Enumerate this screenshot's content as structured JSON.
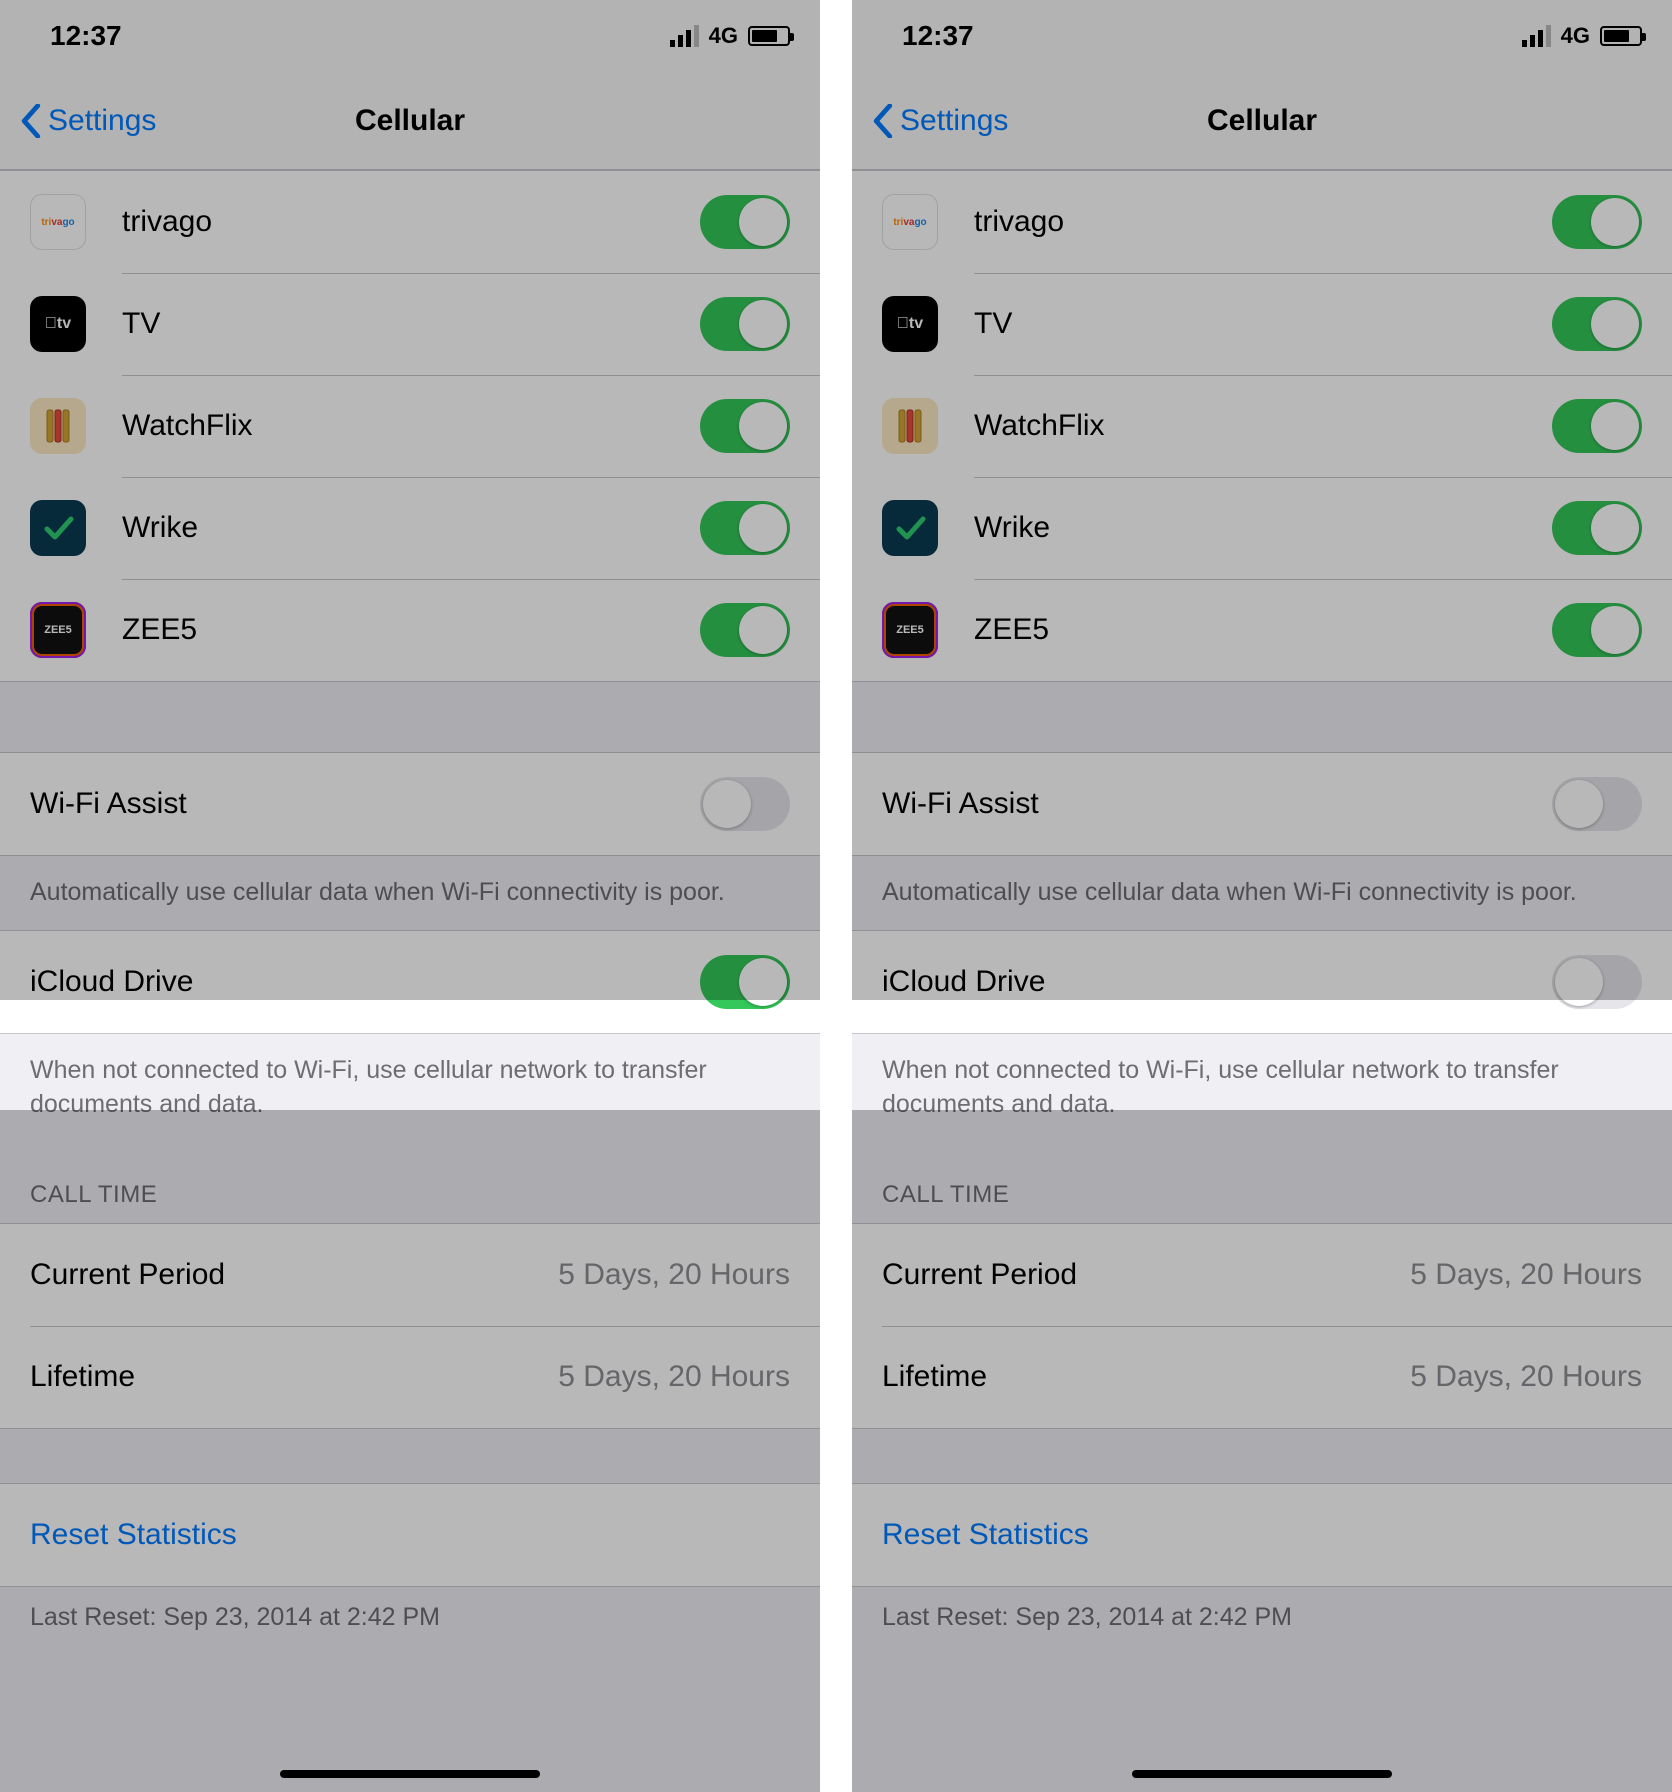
{
  "status": {
    "time": "12:37",
    "network": "4G"
  },
  "nav": {
    "back_label": "Settings",
    "title": "Cellular"
  },
  "apps": [
    {
      "name": "trivago",
      "icon": "trivago-icon",
      "on": true
    },
    {
      "name": "TV",
      "icon": "appletv-icon",
      "on": true
    },
    {
      "name": "WatchFlix",
      "icon": "watchflix-icon",
      "on": true
    },
    {
      "name": "Wrike",
      "icon": "wrike-icon",
      "on": true
    },
    {
      "name": "ZEE5",
      "icon": "zee5-icon",
      "on": true
    }
  ],
  "wifi_assist": {
    "label": "Wi-Fi Assist",
    "on": false,
    "footer": "Automatically use cellular data when Wi-Fi connectivity is poor."
  },
  "icloud_drive": {
    "label": "iCloud Drive",
    "footer": "When not connected to Wi-Fi, use cellular network to transfer documents and data."
  },
  "icloud_on_left": true,
  "icloud_on_right": false,
  "call_time": {
    "header": "CALL TIME",
    "rows": [
      {
        "label": "Current Period",
        "value": "5 Days, 20 Hours"
      },
      {
        "label": "Lifetime",
        "value": "5 Days, 20 Hours"
      }
    ]
  },
  "reset": {
    "label": "Reset Statistics",
    "last": "Last Reset: Sep 23, 2014 at 2:42 PM"
  }
}
